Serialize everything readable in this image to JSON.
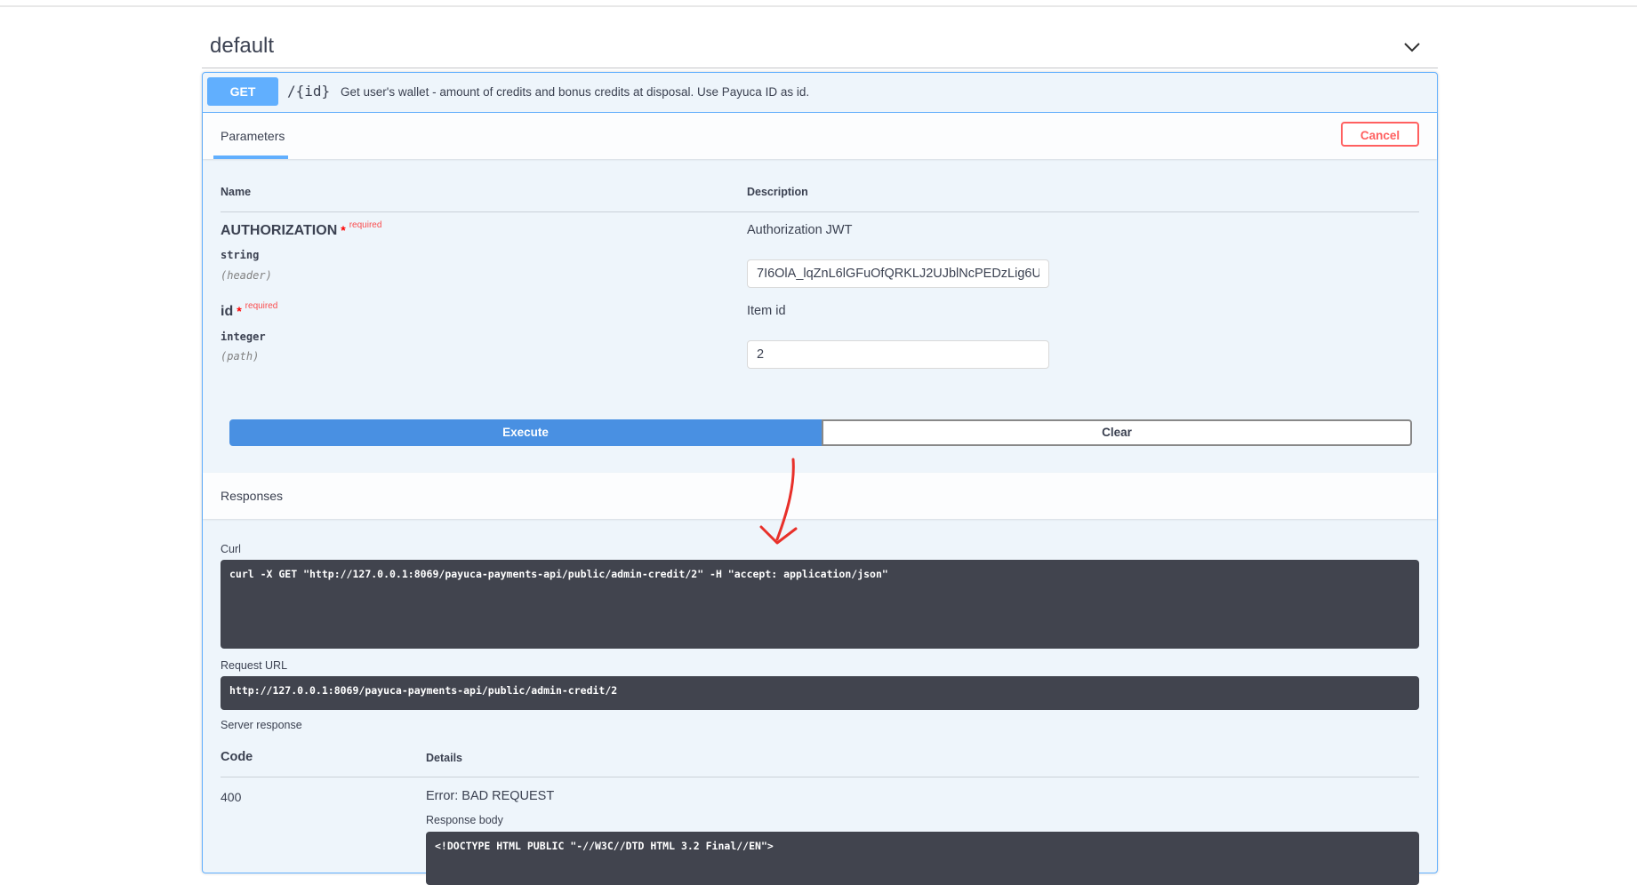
{
  "tag": {
    "title": "default",
    "icon": "chevron-down-icon"
  },
  "operation": {
    "method": "GET",
    "path": "/{id}",
    "summary": "Get user's wallet - amount of credits and bonus credits at disposal. Use Payuca ID as id."
  },
  "parameters": {
    "tab_label": "Parameters",
    "cancel_label": "Cancel",
    "col_name": "Name",
    "col_description": "Description",
    "items": [
      {
        "name": "AUTHORIZATION",
        "required_mark": "*",
        "required_label": "required",
        "type": "string",
        "in": "(header)",
        "description": "Authorization JWT",
        "value": "7I6OlA_lqZnL6lGFuOfQRKLJ2UJblNcPEDzLig6U"
      },
      {
        "name": "id",
        "required_mark": "*",
        "required_label": "required",
        "type": "integer",
        "in": "(path)",
        "description": "Item id",
        "value": "2"
      }
    ]
  },
  "actions": {
    "execute_label": "Execute",
    "clear_label": "Clear"
  },
  "responses": {
    "title": "Responses",
    "curl_label": "Curl",
    "curl": "curl -X GET \"http://127.0.0.1:8069/payuca-payments-api/public/admin-credit/2\" -H \"accept: application/json\"",
    "request_url_label": "Request URL",
    "request_url": "http://127.0.0.1:8069/payuca-payments-api/public/admin-credit/2",
    "server_response_label": "Server response",
    "col_code": "Code",
    "col_details": "Details",
    "code": "400",
    "error": "Error: BAD REQUEST",
    "body_label": "Response body",
    "body": "<!DOCTYPE HTML PUBLIC \"-//W3C//DTD HTML 3.2 Final//EN\">"
  },
  "colors": {
    "get_method": "#61affe",
    "execute": "#4990e2",
    "cancel": "#ff6060",
    "code_bg": "#41444e",
    "annotation_arrow": "#e8302a"
  }
}
